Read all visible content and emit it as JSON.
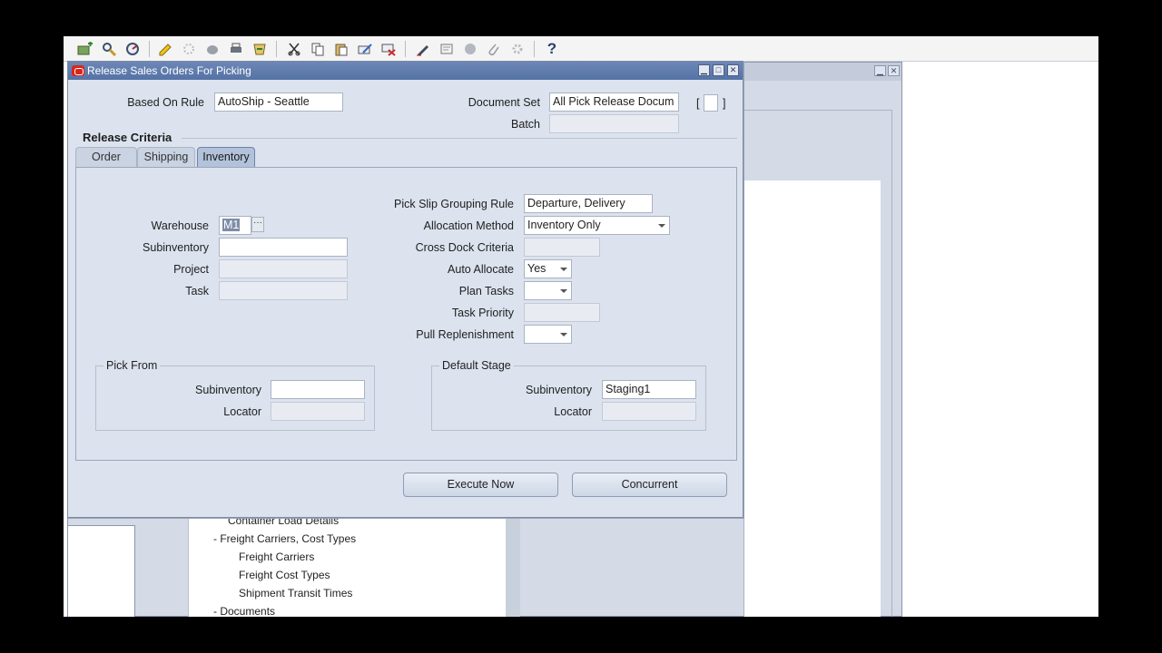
{
  "toolbar": {
    "icons": [
      "new-record-icon",
      "find-icon",
      "navigator-icon",
      "save-icon",
      "next-step-icon",
      "switch-responsibility-icon",
      "print-icon",
      "close-form-icon",
      "cut-icon",
      "copy-icon",
      "paste-icon",
      "clear-record-icon",
      "delete-record-icon",
      "edit-field-icon",
      "zoom-icon",
      "translations-icon",
      "attachments-icon",
      "folder-tools-icon",
      "help-icon"
    ],
    "help_glyph": "?"
  },
  "background": {
    "tree_items": [
      "Container Load Details",
      "-  Freight Carriers, Cost Types",
      "Freight Carriers",
      "Freight Cost Types",
      "Shipment Transit Times",
      "-  Documents"
    ]
  },
  "dialog": {
    "title": "Release Sales Orders For Picking",
    "based_on_rule_label": "Based On Rule",
    "based_on_rule_value": "AutoShip - Seattle",
    "document_set_label": "Document Set",
    "document_set_value": "All Pick Release Docum",
    "document_set_bracket_open": "[",
    "document_set_bracket_close": "]",
    "batch_label": "Batch",
    "batch_value": "",
    "release_criteria_label": "Release Criteria",
    "tabs": [
      {
        "label": "Order",
        "active": false
      },
      {
        "label": "Shipping",
        "active": false
      },
      {
        "label": "Inventory",
        "active": true
      }
    ],
    "inventory": {
      "warehouse_label": "Warehouse",
      "warehouse_value": "M1",
      "lov_glyph": "···",
      "subinventory_label": "Subinventory",
      "subinventory_value": "",
      "project_label": "Project",
      "task_label": "Task",
      "pick_slip_label": "Pick Slip Grouping Rule",
      "pick_slip_value": "Departure, Delivery",
      "allocation_label": "Allocation Method",
      "allocation_value": "Inventory Only",
      "cross_dock_label": "Cross Dock Criteria",
      "auto_allocate_label": "Auto Allocate",
      "auto_allocate_value": "Yes",
      "plan_tasks_label": "Plan Tasks",
      "plan_tasks_value": "",
      "task_priority_label": "Task Priority",
      "pull_replenishment_label": "Pull Replenishment",
      "pull_replenishment_value": "",
      "pick_from": {
        "title": "Pick From",
        "subinventory_label": "Subinventory",
        "subinventory_value": "",
        "locator_label": "Locator",
        "locator_value": ""
      },
      "default_stage": {
        "title": "Default Stage",
        "subinventory_label": "Subinventory",
        "subinventory_value": "Staging1",
        "locator_label": "Locator",
        "locator_value": ""
      }
    },
    "buttons": {
      "execute_now": "Execute Now",
      "concurrent": "Concurrent"
    }
  }
}
